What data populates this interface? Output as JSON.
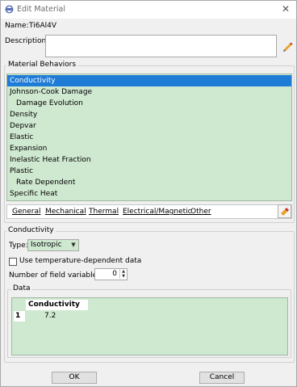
{
  "window": {
    "title": "Edit Material",
    "close_glyph": "✕"
  },
  "material": {
    "name_label": "Name:",
    "name_value": "Ti6Al4V",
    "description_label": "Description:",
    "description_value": ""
  },
  "behaviors": {
    "group_title": "Material Behaviors",
    "items": [
      {
        "label": "Conductivity",
        "selected": true,
        "indent": false
      },
      {
        "label": "Johnson-Cook Damage",
        "selected": false,
        "indent": false
      },
      {
        "label": "Damage Evolution",
        "selected": false,
        "indent": true
      },
      {
        "label": "Density",
        "selected": false,
        "indent": false
      },
      {
        "label": "Depvar",
        "selected": false,
        "indent": false
      },
      {
        "label": "Elastic",
        "selected": false,
        "indent": false
      },
      {
        "label": "Expansion",
        "selected": false,
        "indent": false
      },
      {
        "label": "Inelastic Heat Fraction",
        "selected": false,
        "indent": false
      },
      {
        "label": "Plastic",
        "selected": false,
        "indent": false
      },
      {
        "label": "Rate Dependent",
        "selected": false,
        "indent": true
      },
      {
        "label": "Specific Heat",
        "selected": false,
        "indent": false
      }
    ]
  },
  "menu": {
    "items": [
      "General",
      "Mechanical",
      "Thermal",
      "Electrical/Magnetic",
      "Other"
    ]
  },
  "conductivity": {
    "group_title": "Conductivity",
    "type_label": "Type:",
    "type_value": "Isotropic",
    "temp_dependent_label": "Use temperature-dependent data",
    "temp_dependent_checked": false,
    "field_vars_label": "Number of field variables:",
    "field_vars_value": "0"
  },
  "data": {
    "group_title": "Data",
    "columns": [
      "Conductivity"
    ],
    "rows": [
      {
        "num": "1",
        "values": [
          "7.2"
        ]
      }
    ]
  },
  "buttons": {
    "ok": "OK",
    "cancel": "Cancel"
  },
  "colors": {
    "accent": "#1e7bd6",
    "table_bg": "#cfe8d0"
  }
}
